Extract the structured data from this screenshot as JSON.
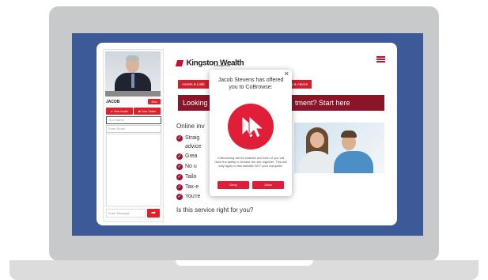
{
  "agent_panel": {
    "agent_name": "JACOB",
    "end_label": "End",
    "audio_label": "Your Audio",
    "video_label": "Your Video",
    "name_placeholder": "Your Name",
    "email_placeholder": "Enter Email",
    "message_placeholder": "Enter Message"
  },
  "site": {
    "logo_name": "Kingston Wealth",
    "logo_sub": "Management",
    "tab_left": "Assets & Liabi",
    "tab_right": "g & Advice",
    "banner_left": "Looking",
    "banner_right": "tment? Start here",
    "heading": "Online inv",
    "bullets": [
      "Straig",
      "Grea",
      "No u",
      "Tailo",
      "Tax-e",
      "You're"
    ],
    "advice_text": "advice",
    "question": "Is this service right for you?"
  },
  "popup": {
    "title": "Jacob Stevens has offered you to CoBrowse:",
    "description": "CoBrowsing will be enabled and both of you will have the ability to browse the site together. This will only apply to this website NOT your computer.",
    "deny_label": "Deny",
    "allow_label": "Allow",
    "close_icon": "close-icon",
    "cobrowse_icon": "double-cursor-icon"
  },
  "colors": {
    "brand_red": "#e01e37",
    "banner_maroon": "#8a1428",
    "screen_blue": "#3d5a98"
  }
}
